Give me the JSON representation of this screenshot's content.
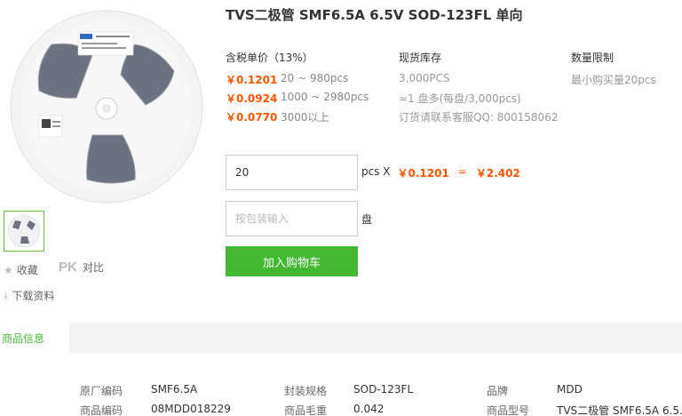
{
  "product": {
    "title": "TVS二极管 SMF6.5A 6.5V SOD-123FL 单向",
    "reel_label_text": "MFG P/N SMF6.5A"
  },
  "actions": {
    "favorite": "收藏",
    "pk_badge": "PK",
    "compare": "对比",
    "download": "下载资料"
  },
  "pricing": {
    "header": "含税单价（13%）",
    "tiers": [
      {
        "price": "￥0.1201",
        "qty": "20 ~ 980pcs"
      },
      {
        "price": "￥0.0924",
        "qty": "1000 ~ 2980pcs"
      },
      {
        "price": "￥0.0770",
        "qty": "3000以上"
      }
    ]
  },
  "stock": {
    "header": "现货库存",
    "amount": "3,000PCS",
    "reels": "≈1 盘多(每盘/3,000pcs)",
    "service": "订货请联系客服QQ: 800158062"
  },
  "limit": {
    "header": "数量限制",
    "min": "最小购买量20pcs"
  },
  "order": {
    "qty_value": "20",
    "unit_x": "pcs X",
    "unit_price": "￥0.1201",
    "equals": "=",
    "total": "￥2.402",
    "pkg_placeholder": "按包装输入",
    "pkg_unit": "盘",
    "add_to_cart": "加入购物车"
  },
  "tabs": {
    "product_info": "商品信息"
  },
  "specs": [
    {
      "label": "原厂编码",
      "value": "SMF6.5A"
    },
    {
      "label": "封装规格",
      "value": "SOD-123FL"
    },
    {
      "label": "品牌",
      "value": "MDD"
    },
    {
      "label": "商品编码",
      "value": "08MDD018229"
    },
    {
      "label": "商品毛重",
      "value": "0.042"
    },
    {
      "label": "商品型号",
      "value": "TVS二极管 SMF6.5A 6.5..."
    }
  ],
  "colors": {
    "accent_green": "#43b833",
    "price_orange": "#ff5500"
  }
}
